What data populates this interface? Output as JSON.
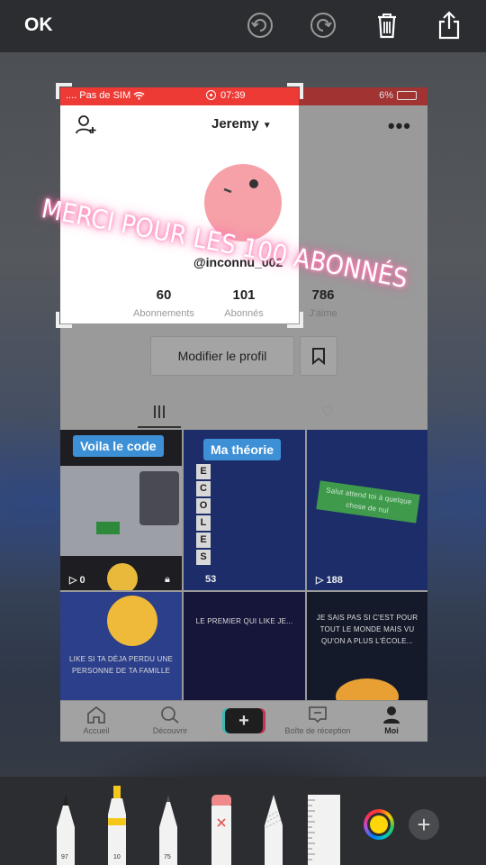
{
  "top_bar": {
    "ok_label": "OK",
    "undo_icon": "undo-icon",
    "redo_icon": "redo-icon",
    "trash_icon": "trash-icon",
    "share_icon": "share-icon"
  },
  "screenshot": {
    "status_bar": {
      "carrier": ".... Pas de SIM",
      "time": "07:39",
      "battery": "6%"
    },
    "profile": {
      "username": "Jeremy",
      "handle": "@inconnu_002",
      "stats": [
        {
          "value": "60",
          "label": "Abonnements"
        },
        {
          "value": "101",
          "label": "Abonnés"
        },
        {
          "value": "786",
          "label": "J'aime"
        }
      ],
      "edit_profile_label": "Modifier le profil"
    },
    "overlay_text": "MERCI POUR LES 100 ABONNÉS",
    "videos": [
      {
        "caption": "Voila le code",
        "views": "0"
      },
      {
        "caption": "Ma théorie",
        "views": "53",
        "letters": [
          "E",
          "C",
          "O",
          "L",
          "E",
          "S"
        ]
      },
      {
        "caption": "Salut attend toi à quelque chose de nul",
        "views": "188"
      },
      {
        "caption": "LIKE SI TA DÉJA PERDU UNE PERSONNE DE TA FAMILLE"
      },
      {
        "caption": "LE PREMIER QUI LIKE JE..."
      },
      {
        "caption": "JE SAIS PAS SI C'EST POUR TOUT LE MONDE MAIS VU QU'ON A PLUS L'ÉCOLE..."
      }
    ],
    "bottom_nav": [
      {
        "label": "Accueil",
        "icon": "home-icon"
      },
      {
        "label": "Découvrir",
        "icon": "search-icon"
      },
      {
        "label": "",
        "icon": "plus-icon"
      },
      {
        "label": "Boîte de réception",
        "icon": "inbox-icon"
      },
      {
        "label": "Moi",
        "icon": "profile-icon"
      }
    ]
  },
  "tools": [
    {
      "name": "pen",
      "value": "97"
    },
    {
      "name": "marker",
      "value": "10"
    },
    {
      "name": "pencil",
      "value": "75"
    },
    {
      "name": "eraser"
    },
    {
      "name": "lasso"
    },
    {
      "name": "ruler"
    }
  ],
  "colors": {
    "selected": "#ffd60a",
    "crop_status": "#ee3a35",
    "avatar": "#f6a0a8"
  }
}
